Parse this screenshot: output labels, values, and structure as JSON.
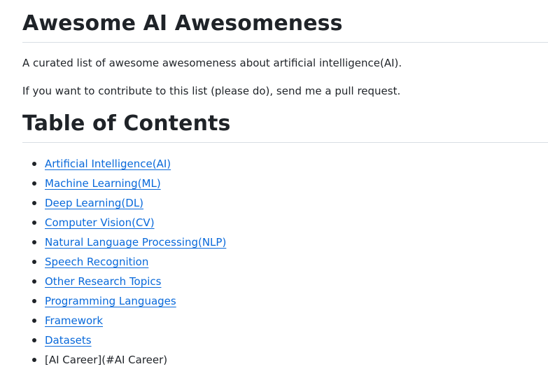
{
  "readme": {
    "title": "Awesome AI Awesomeness",
    "intro": "A curated list of awesome awesomeness about artificial intelligence(AI).",
    "contribute": "If you want to contribute to this list (please do), send me a pull request.",
    "toc_heading": "Table of Contents",
    "toc": [
      {
        "label": "Artificial Intelligence(AI)",
        "link": true
      },
      {
        "label": "Machine Learning(ML)",
        "link": true
      },
      {
        "label": "Deep Learning(DL)",
        "link": true
      },
      {
        "label": "Computer Vision(CV)",
        "link": true
      },
      {
        "label": "Natural Language Processing(NLP)",
        "link": true
      },
      {
        "label": "Speech Recognition",
        "link": true
      },
      {
        "label": "Other Research Topics",
        "link": true
      },
      {
        "label": "Programming Languages",
        "link": true
      },
      {
        "label": "Framework",
        "link": true
      },
      {
        "label": "Datasets",
        "link": true
      },
      {
        "label": "[AI Career](#AI Career)",
        "link": false
      }
    ],
    "colors": {
      "link": "#0969da",
      "text": "#1f2328",
      "divider": "#d8dee4"
    }
  }
}
